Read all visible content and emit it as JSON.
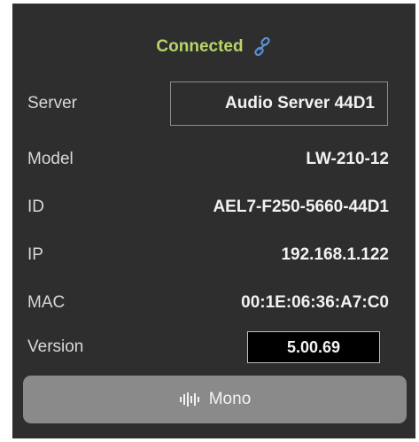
{
  "status": {
    "text": "Connected",
    "icon": "link-icon",
    "color": "#b8d46a"
  },
  "server": {
    "label": "Server",
    "value": "Audio Server 44D1"
  },
  "model": {
    "label": "Model",
    "value": "LW-210-12"
  },
  "id": {
    "label": "ID",
    "value": "AEL7-F250-5660-44D1"
  },
  "ip": {
    "label": "IP",
    "value": "192.168.1.122"
  },
  "mac": {
    "label": "MAC",
    "value": "00:1E:06:36:A7:C0"
  },
  "version": {
    "label": "Version",
    "value": "5.00.69"
  },
  "mono_button": {
    "label": "Mono",
    "icon": "audio-wave-icon"
  }
}
